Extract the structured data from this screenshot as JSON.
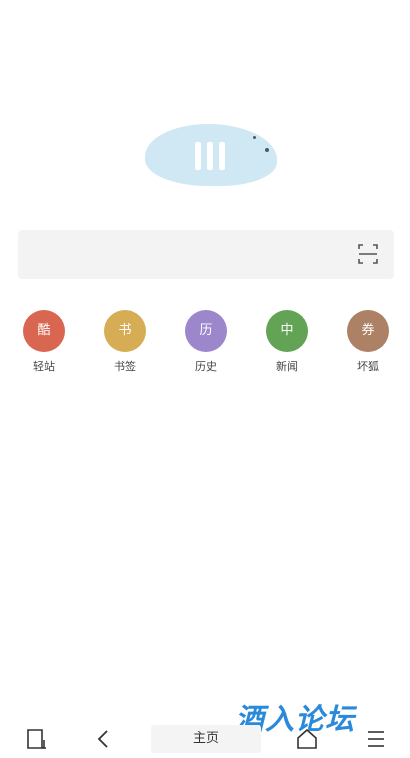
{
  "logo": {
    "color": "#cfe8f4"
  },
  "search": {
    "icon": "scan-icon"
  },
  "shortcuts": [
    {
      "glyph": "酷",
      "label": "轻站",
      "color": "#d96650"
    },
    {
      "glyph": "书",
      "label": "书签",
      "color": "#d6ac55"
    },
    {
      "glyph": "历",
      "label": "历史",
      "color": "#9c86cc"
    },
    {
      "glyph": "中",
      "label": "新闻",
      "color": "#63a356"
    },
    {
      "glyph": "券",
      "label": "坏狐",
      "color": "#ad8165"
    }
  ],
  "bottombar": {
    "home_label": "主页",
    "icons": [
      "tabs-icon",
      "back-icon",
      "home-icon",
      "menu-icon"
    ]
  },
  "watermark": {
    "text": "酒入论坛",
    "color": "#1f84d8"
  }
}
